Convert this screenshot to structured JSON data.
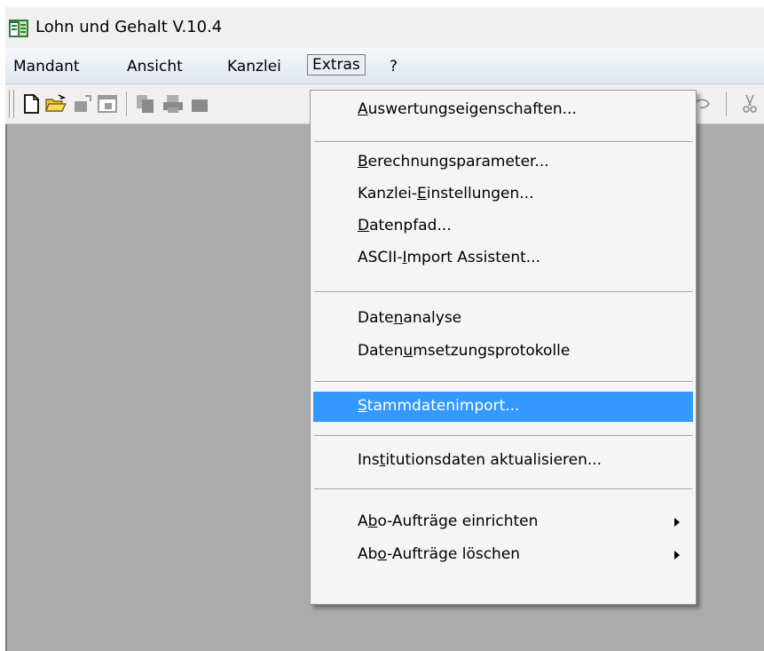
{
  "window": {
    "title": "Lohn und Gehalt V.10.4"
  },
  "menubar": {
    "items": [
      {
        "label": "Mandant"
      },
      {
        "label": "Ansicht"
      },
      {
        "label": "Kanzlei"
      },
      {
        "label": "Extras"
      },
      {
        "label": "?"
      }
    ]
  },
  "extras_menu": {
    "items": [
      {
        "label": "Auswertungseigenschaften...",
        "mnemonic": "A"
      },
      {
        "label": "Berechnungsparameter...",
        "mnemonic": "B"
      },
      {
        "label": "Kanzlei-Einstellungen...",
        "mnemonic": "E"
      },
      {
        "label": "Datenpfad...",
        "mnemonic": "D"
      },
      {
        "label": "ASCII-Import Assistent...",
        "mnemonic": "I"
      },
      {
        "label": "Datenanalyse",
        "mnemonic": "n"
      },
      {
        "label": "Datenumsetzungsprotokolle",
        "mnemonic": "u"
      },
      {
        "label": "Stammdatenimport...",
        "mnemonic": "S",
        "highlighted": true
      },
      {
        "label": "Institutionsdaten aktualisieren...",
        "mnemonic": "t"
      },
      {
        "label": "Abo-Aufträge einrichten",
        "mnemonic": "b",
        "submenu": true
      },
      {
        "label": "Abo-Aufträge löschen",
        "mnemonic": "o",
        "submenu": true
      }
    ]
  },
  "toolbar": {
    "icons": [
      "new-document-icon",
      "open-folder-icon",
      "export-icon",
      "window-icon",
      "copy-icon",
      "print-icon",
      "print-preview-icon",
      "undo-icon",
      "cut-icon"
    ]
  },
  "colors": {
    "highlight": "#3399ff",
    "workspace": "#ababab",
    "menu_bg": "#f5f5f5"
  }
}
